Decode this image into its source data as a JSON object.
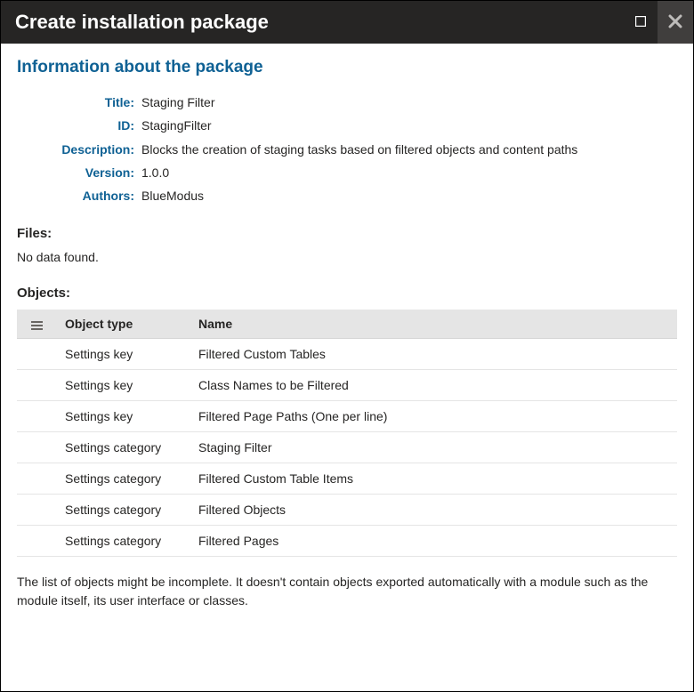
{
  "window": {
    "title": "Create installation package"
  },
  "section_heading": "Information about the package",
  "info": {
    "title_label": "Title:",
    "title_value": "Staging Filter",
    "id_label": "ID:",
    "id_value": "StagingFilter",
    "description_label": "Description:",
    "description_value": "Blocks the creation of staging tasks based on filtered objects and content paths",
    "version_label": "Version:",
    "version_value": "1.0.0",
    "authors_label": "Authors:",
    "authors_value": "BlueModus"
  },
  "files": {
    "heading": "Files:",
    "empty_text": "No data found."
  },
  "objects": {
    "heading": "Objects:",
    "columns": {
      "type": "Object type",
      "name": "Name"
    },
    "rows": [
      {
        "type": "Settings key",
        "name": "Filtered Custom Tables"
      },
      {
        "type": "Settings key",
        "name": "Class Names to be Filtered"
      },
      {
        "type": "Settings key",
        "name": "Filtered Page Paths (One per line)"
      },
      {
        "type": "Settings category",
        "name": "Staging Filter"
      },
      {
        "type": "Settings category",
        "name": "Filtered Custom Table Items"
      },
      {
        "type": "Settings category",
        "name": "Filtered Objects"
      },
      {
        "type": "Settings category",
        "name": "Filtered Pages"
      }
    ]
  },
  "footer_note": "The list of objects might be incomplete. It doesn't contain objects exported automatically with a module such as the module itself, its user interface or classes."
}
